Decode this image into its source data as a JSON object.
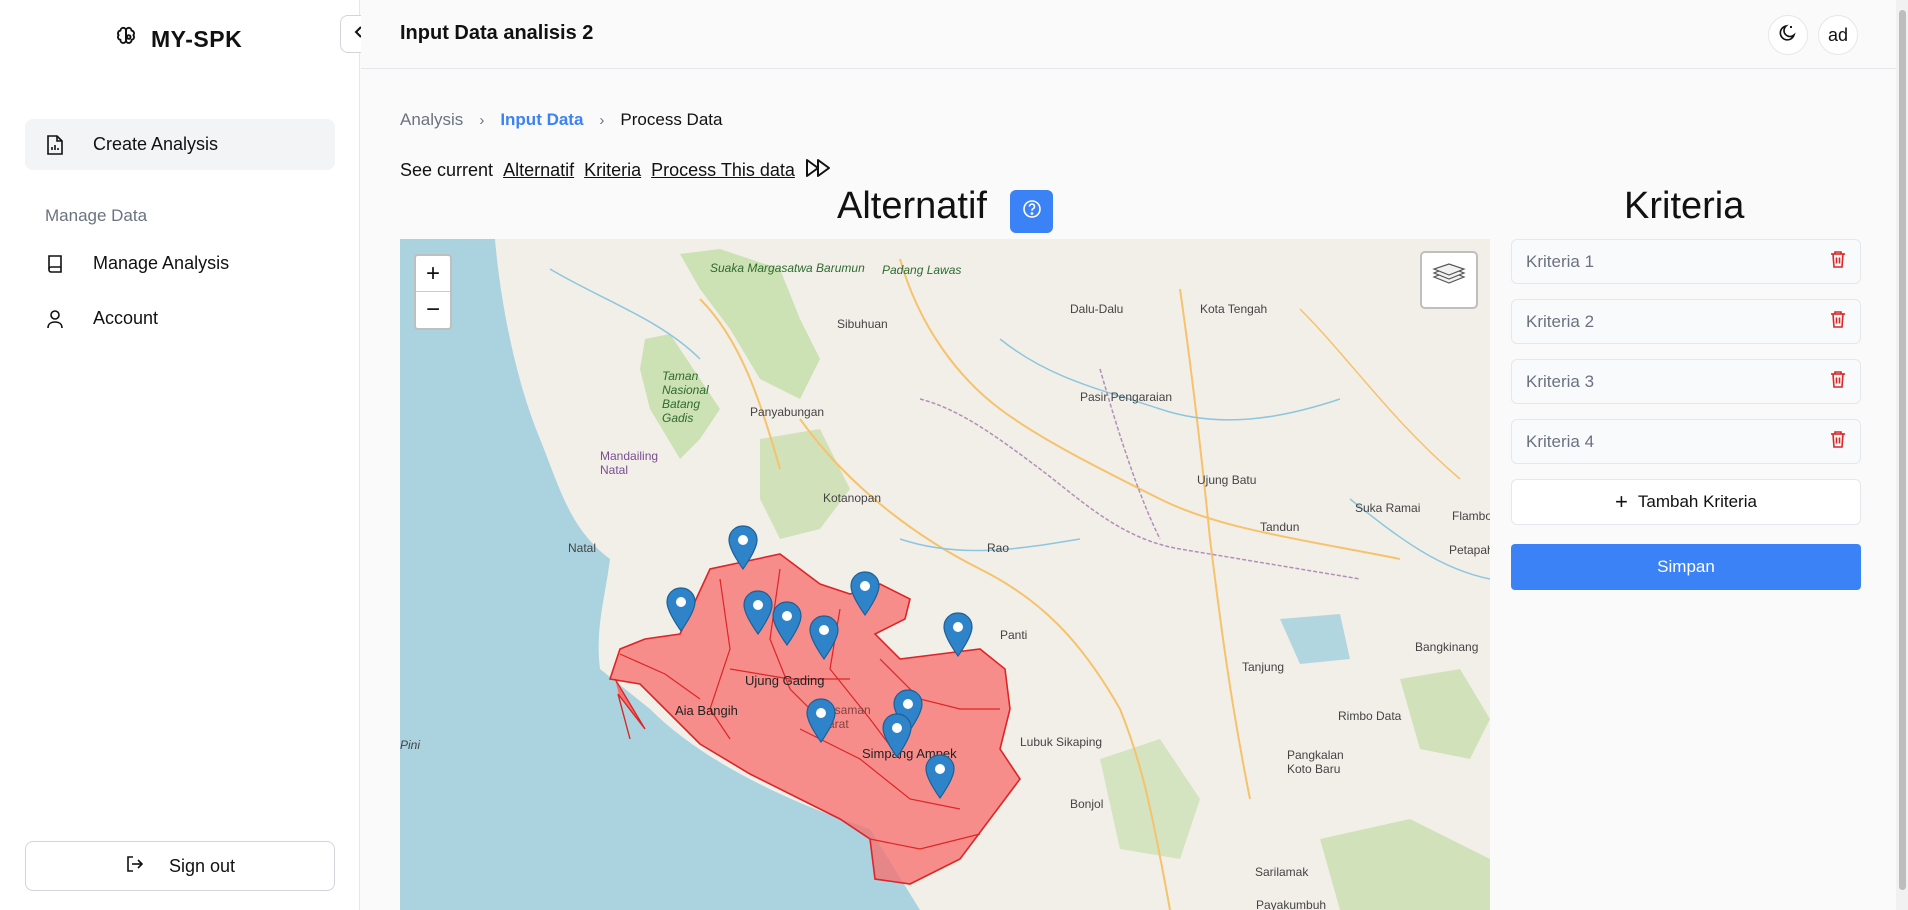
{
  "brand": {
    "name": "MY-SPK",
    "icon": "brain-icon"
  },
  "sidebar": {
    "create_analysis": "Create Analysis",
    "section_label": "Manage Data",
    "manage_analysis": "Manage Analysis",
    "account": "Account",
    "sign_out": "Sign out"
  },
  "header": {
    "title": "Input Data analisis 2",
    "avatar": "ad",
    "theme_icon": "moon-icon"
  },
  "breadcrumb": {
    "analysis": "Analysis",
    "input_data": "Input Data",
    "process_data": "Process Data"
  },
  "see_current": {
    "label": "See current",
    "alternatif": "Alternatif",
    "kriteria": "Kriteria",
    "process": "Process This data"
  },
  "alternatif": {
    "title": "Alternatif"
  },
  "map": {
    "zoom_in": "+",
    "zoom_out": "−",
    "labels": [
      "Suaka Margasatwa Barumun",
      "Padang Lawas",
      "Sibuhuan",
      "Dalu-Dalu",
      "Kota Tengah",
      "Taman Nasional Batang Gadis",
      "Panyabungan",
      "Pasir Pengaraian",
      "Mandailing Natal",
      "Kotanopan",
      "Ujung Batu",
      "Suka Ramai",
      "Tandun",
      "Flambo",
      "Natal",
      "Rao",
      "Petapah",
      "Panti",
      "Bangkinang",
      "Ujung Gading",
      "Tanjung",
      "Aia Bangih",
      "Pasaman Barat",
      "Rimbo Data",
      "Lubuk Sikaping",
      "Simpang Ampek",
      "Pangkalan Koto Baru",
      "Pini",
      "Bonjol",
      "Sarilamak",
      "Payakumbuh"
    ]
  },
  "kriteria": {
    "title": "Kriteria",
    "items": [
      "Kriteria 1",
      "Kriteria 2",
      "Kriteria 3",
      "Kriteria 4"
    ],
    "add_label": "Tambah Kriteria",
    "save_label": "Simpan"
  },
  "colors": {
    "accent": "#3b82f6",
    "danger": "#dc2626",
    "region_fill": "#f87171",
    "sea": "#aad3df"
  }
}
